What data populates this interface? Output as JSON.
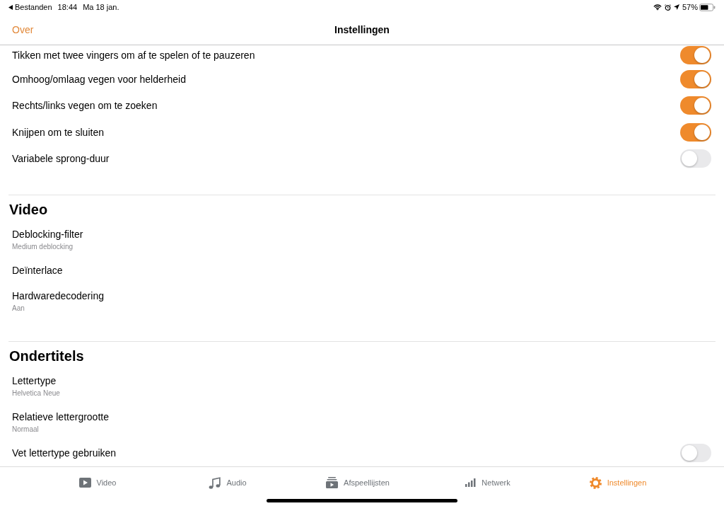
{
  "status_bar": {
    "back_app": "Bestanden",
    "time": "18:44",
    "date": "Ma 18 jan.",
    "battery": "57%"
  },
  "nav_bar": {
    "back_button": "Over",
    "title": "Instellingen"
  },
  "sections": [
    {
      "rows": [
        {
          "kind": "toggle",
          "label": "Tikken met twee vingers om af te spelen of te pauzeren",
          "on": true
        },
        {
          "kind": "toggle",
          "label": "Omhoog/omlaag vegen voor helderheid",
          "on": true
        },
        {
          "kind": "toggle",
          "label": "Rechts/links vegen om te zoeken",
          "on": true
        },
        {
          "kind": "toggle",
          "label": "Knijpen om te sluiten",
          "on": true
        },
        {
          "kind": "toggle",
          "label": "Variabele sprong-duur",
          "on": false
        }
      ]
    },
    {
      "title": "Video",
      "rows": [
        {
          "kind": "detail",
          "label": "Deblocking-filter",
          "value": "Medium deblocking"
        },
        {
          "kind": "detail",
          "label": "Deïnterlace"
        },
        {
          "kind": "detail",
          "label": "Hardwaredecodering",
          "value": "Aan"
        }
      ]
    },
    {
      "title": "Ondertitels",
      "rows": [
        {
          "kind": "detail",
          "label": "Lettertype",
          "value": "Helvetica Neue"
        },
        {
          "kind": "detail",
          "label": "Relatieve lettergrootte",
          "value": "Normaal"
        },
        {
          "kind": "toggle",
          "label": "Vet lettertype gebruiken",
          "on": false
        }
      ]
    }
  ],
  "tab_bar": [
    {
      "label": "Video",
      "selected": false
    },
    {
      "label": "Audio",
      "selected": false
    },
    {
      "label": "Afspeellijsten",
      "selected": false
    },
    {
      "label": "Netwerk",
      "selected": false
    },
    {
      "label": "Instellingen",
      "selected": true
    }
  ]
}
